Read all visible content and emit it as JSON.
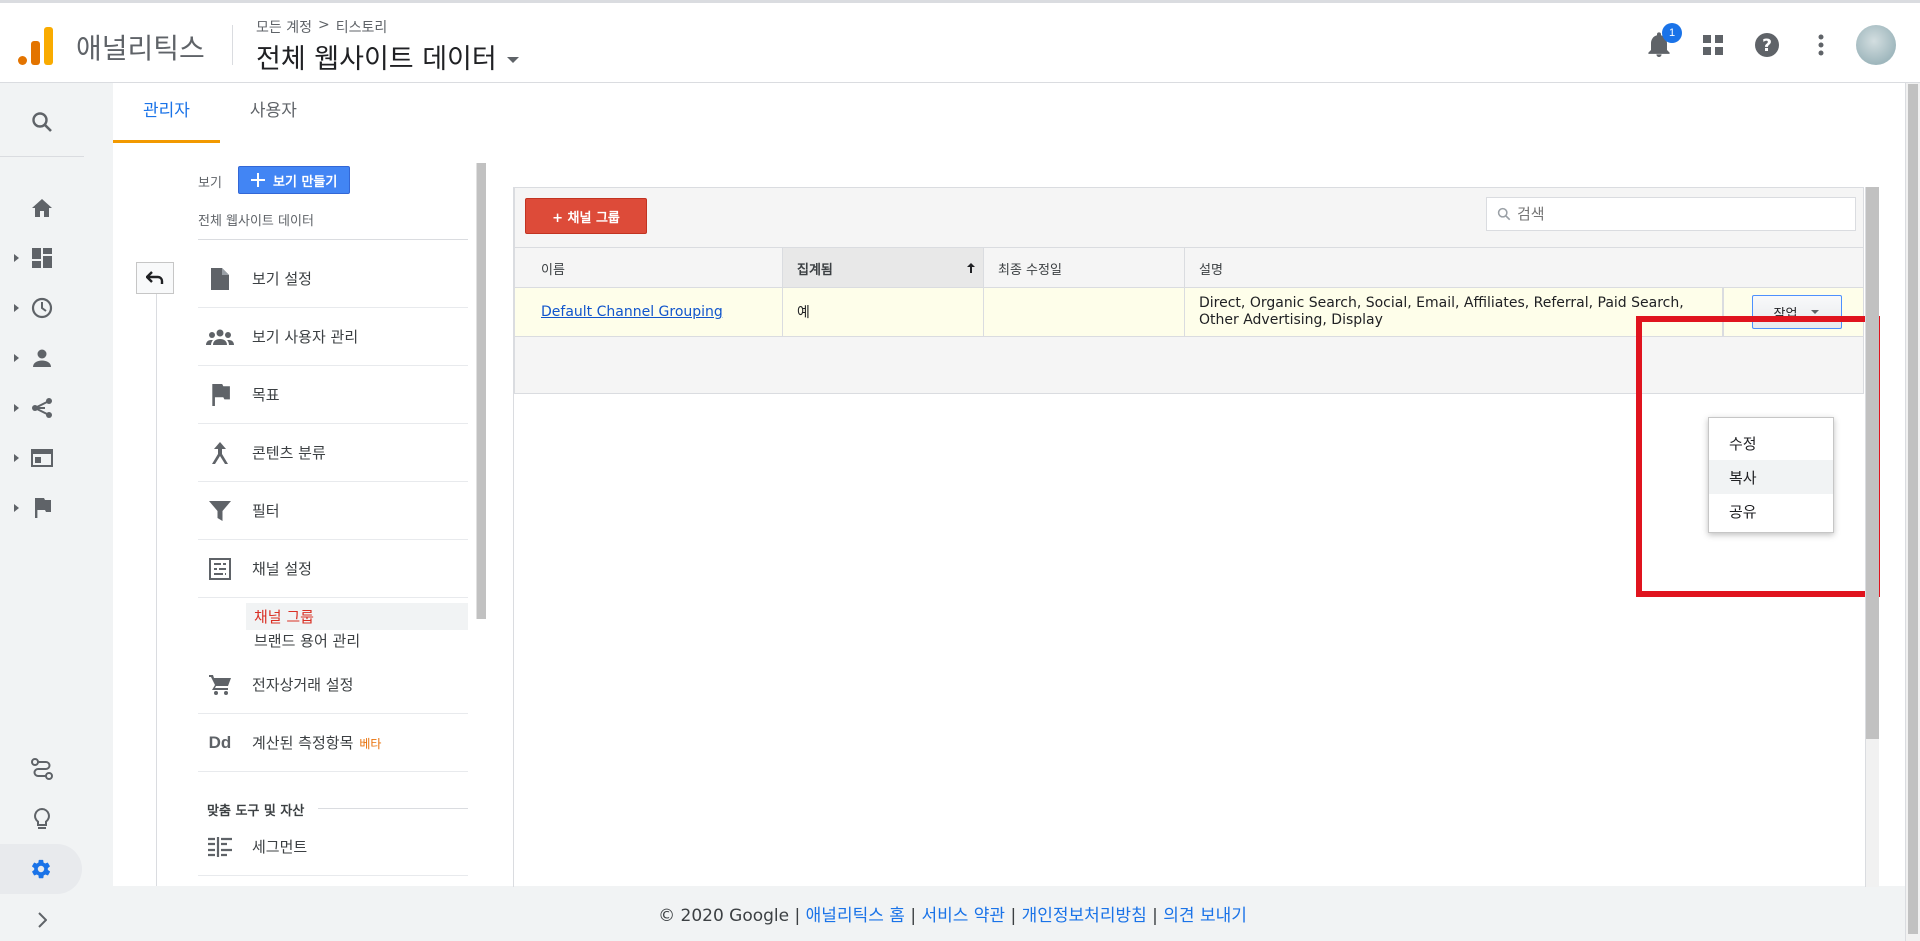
{
  "app": {
    "name": "애널리틱스"
  },
  "header": {
    "breadcrumb": [
      "모든 계정",
      ">",
      "티스토리"
    ],
    "view_title": "전체 웹사이트 데이터",
    "notification_count": "1"
  },
  "tabs": [
    {
      "label": "관리자",
      "active": true
    },
    {
      "label": "사용자",
      "active": false
    }
  ],
  "admin": {
    "view_label": "보기",
    "create_view_label": "보기 만들기",
    "current_view": "전체 웹사이트 데이터",
    "items": [
      {
        "label": "보기 설정",
        "icon": "document-icon"
      },
      {
        "label": "보기 사용자 관리",
        "icon": "people-icon"
      },
      {
        "label": "목표",
        "icon": "flag-icon"
      },
      {
        "label": "콘텐츠 분류",
        "icon": "content-grouping-icon"
      },
      {
        "label": "필터",
        "icon": "filter-icon"
      },
      {
        "label": "채널 설정",
        "icon": "channel-settings-icon"
      }
    ],
    "channel_subitems": [
      "채널 그룹",
      "브랜드 용어 관리"
    ],
    "items2": [
      {
        "label": "전자상거래 설정",
        "icon": "cart-icon"
      },
      {
        "label": "계산된 측정항목",
        "icon": "dd-icon",
        "badge": "베타"
      }
    ],
    "section_label": "맞춤 도구 및 자산",
    "segment_label": "세그먼트"
  },
  "panel": {
    "add_button": "+ 채널 그룹",
    "search_placeholder": "검색",
    "columns": [
      "이름",
      "집계됨",
      "최종 수정일",
      "설명"
    ],
    "rows": [
      {
        "name": "Default Channel Grouping",
        "aggregated": "예",
        "modified": "",
        "description": "Direct, Organic Search, Social, Email, Affiliates, Referral, Paid Search, Other Advertising, Display",
        "action_label": "작업"
      }
    ],
    "action_menu": [
      "수정",
      "복사",
      "공유"
    ]
  },
  "footer": {
    "copyright": "© 2020 Google",
    "links": [
      "애널리틱스 홈",
      "서비스 약관",
      "개인정보처리방침",
      "의견 보내기"
    ]
  },
  "colors": {
    "accent": "#1a73e8",
    "tab_underline": "#f29900",
    "add_button": "#dd4b39",
    "highlight_box": "#e0141e"
  }
}
